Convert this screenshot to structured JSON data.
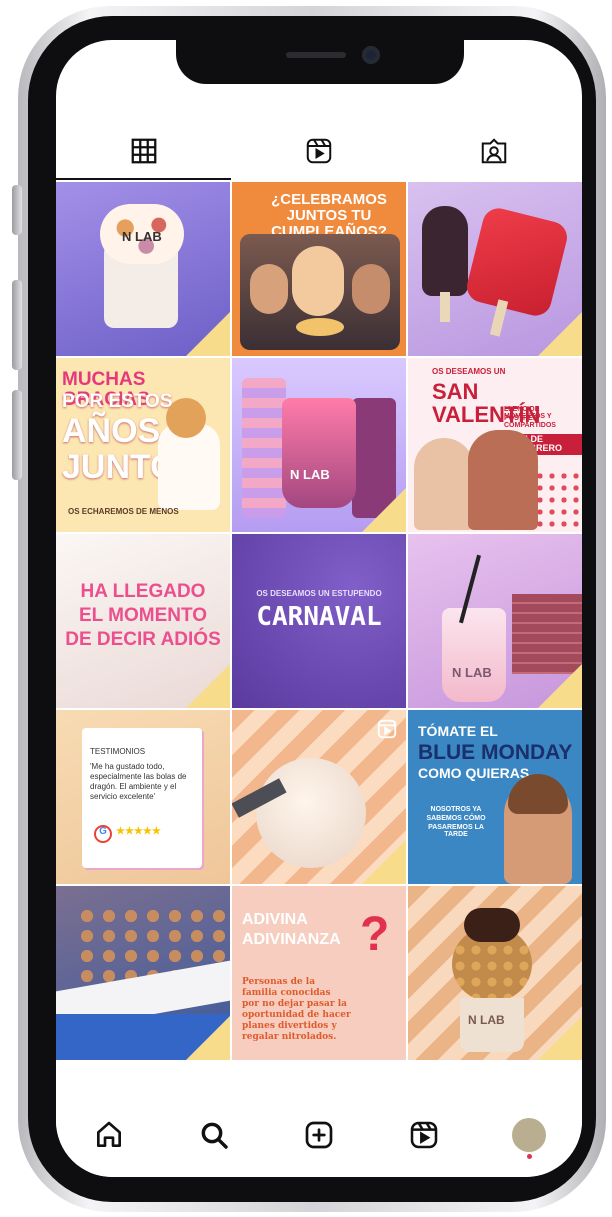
{
  "profile_tabs": [
    {
      "name": "grid",
      "icon": "grid-icon",
      "active": true
    },
    {
      "name": "reels",
      "icon": "reels-icon",
      "active": false
    },
    {
      "name": "tagged",
      "icon": "tagged-icon",
      "active": false
    }
  ],
  "posts": [
    {
      "caption": "N LAB",
      "bg": "#8d7ad8"
    },
    {
      "caption": "¿CELEBRAMOS JUNTOS TU CUMPLEAÑOS?",
      "bg": "#f08a3d"
    },
    {
      "caption": "",
      "bg": "#c9a6e6"
    },
    {
      "caption_lines": [
        "MUCHAS GRACIAS",
        "POR ESTOS",
        "AÑOS",
        "JUNTOS"
      ],
      "footer": "OS ECHAREMOS DE MENOS",
      "bg": "#fce6b2"
    },
    {
      "caption": "N LAB",
      "bg": "#c9b3ff"
    },
    {
      "kicker": "OS DESEAMOS UN",
      "caption": "SAN VALENTÍN",
      "sub_lines": [
        "LLENO DE MOMENTOS Y",
        "POSTRES COMPARTIDOS"
      ],
      "date": "14 DE FEBRERO",
      "bg": "#fdeff1"
    },
    {
      "caption_lines": [
        "HA LLEGADO",
        "EL MOMENTO",
        "DE DECIR ADIÓS"
      ],
      "bg": "#f7f2ee"
    },
    {
      "kicker": "OS DESEAMOS UN ESTUPENDO",
      "caption": "CARNAVAL",
      "bg": "#6b46b4"
    },
    {
      "caption": "N LAB",
      "bg": "#d7a9e7"
    },
    {
      "card_title": "TESTIMONIOS",
      "quote": "'Me ha gustado todo, especialmente las bolas de dragón. El ambiente y el servicio excelente'",
      "stars": "★★★★★",
      "google": "G",
      "bg": "#f6d7b1"
    },
    {
      "caption": "",
      "bg": "#f2b78c"
    },
    {
      "caption_lines": [
        "TÓMATE EL",
        "BLUE MONDAY",
        "COMO QUIERAS"
      ],
      "sub_lines": [
        "NOSOTROS YA",
        "SABEMOS CÓMO",
        "PASAREMOS LA TARDE"
      ],
      "bg": "#3a87c4"
    },
    {
      "caption": "",
      "bg": "#7b6f91"
    },
    {
      "caption_lines": [
        "ADIVINA",
        "ADIVINANZA"
      ],
      "body_lines": [
        "Personas de la",
        "familia conocidas",
        "por no dejar pasar la",
        "oportunidad de hacer",
        "planes divertidos y",
        "regalar nitrolados."
      ],
      "bg": "#f6cdbf"
    },
    {
      "caption": "N LAB",
      "bg": "#eab487"
    }
  ],
  "bottom_nav": [
    {
      "name": "home",
      "icon": "home-icon"
    },
    {
      "name": "search",
      "icon": "search-icon"
    },
    {
      "name": "create",
      "icon": "plus-square-icon"
    },
    {
      "name": "reels",
      "icon": "reels-icon"
    },
    {
      "name": "profile",
      "icon": "avatar"
    }
  ]
}
